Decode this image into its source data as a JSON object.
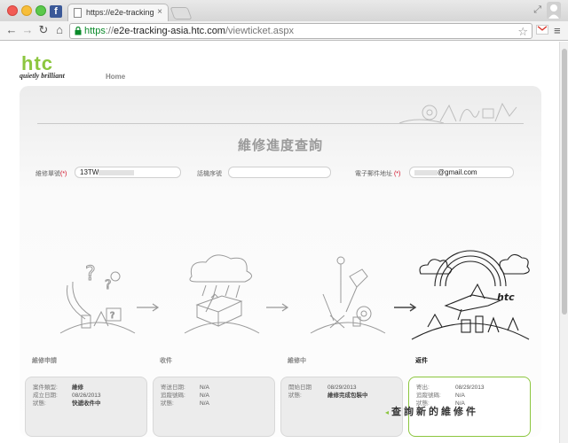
{
  "browser": {
    "tab_title": "https://e2e-tracking-asi...",
    "tab_close": "×",
    "favicon_letter": "f",
    "url_scheme": "https",
    "url_sep": "://",
    "url_host": "e2e-tracking-asia.htc.com",
    "url_path": "/viewticket.aspx",
    "icons": {
      "back": "back-arrow-icon",
      "forward": "forward-arrow-icon",
      "reload": "reload-icon",
      "home": "home-icon",
      "lock": "lock-icon",
      "star": "star-icon",
      "gmail": "gmail-icon",
      "menu": "menu-icon"
    }
  },
  "site": {
    "logo": "htc",
    "tagline": "quietly brilliant",
    "nav_home": "Home",
    "brand_color": "#8cc63f"
  },
  "page": {
    "title": "維修進度查詢",
    "fields": {
      "repair_no": {
        "label": "維修單號",
        "required": "(*)",
        "value": "13TW"
      },
      "serial_no": {
        "label": "話機序號",
        "value": ""
      },
      "email": {
        "label": "電子郵件地址",
        "required": "(*)",
        "value": "@gmail.com"
      }
    },
    "steps": [
      {
        "label": "維修申請",
        "rows": [
          {
            "key": "案件類型:",
            "value": "維修",
            "bold": true
          },
          {
            "key": "成立日期:",
            "value": "08/26/2013",
            "bold": false
          },
          {
            "key": "狀態:",
            "value": "快遞收件中",
            "bold": true
          }
        ]
      },
      {
        "label": "收件",
        "rows": [
          {
            "key": "寄送日期:",
            "value": "N/A",
            "bold": false
          },
          {
            "key": "追蹤號碼:",
            "value": "N/A",
            "bold": false
          },
          {
            "key": "狀態:",
            "value": "N/A",
            "bold": false
          }
        ]
      },
      {
        "label": "維修中",
        "rows": [
          {
            "key": "開始日期",
            "value": "08/29/2013",
            "bold": false
          },
          {
            "key": "狀態:",
            "value": "維修完成包裝中",
            "bold": true
          }
        ]
      },
      {
        "label": "返件",
        "active": true,
        "rows": [
          {
            "key": "寄出:",
            "value": "08/29/2013",
            "bold": false
          },
          {
            "key": "追蹤號碼:",
            "value": "N/A",
            "bold": false
          },
          {
            "key": "狀態:",
            "value": "N/A",
            "bold": false
          }
        ]
      }
    ],
    "query_link": "查詢新的維修件"
  }
}
